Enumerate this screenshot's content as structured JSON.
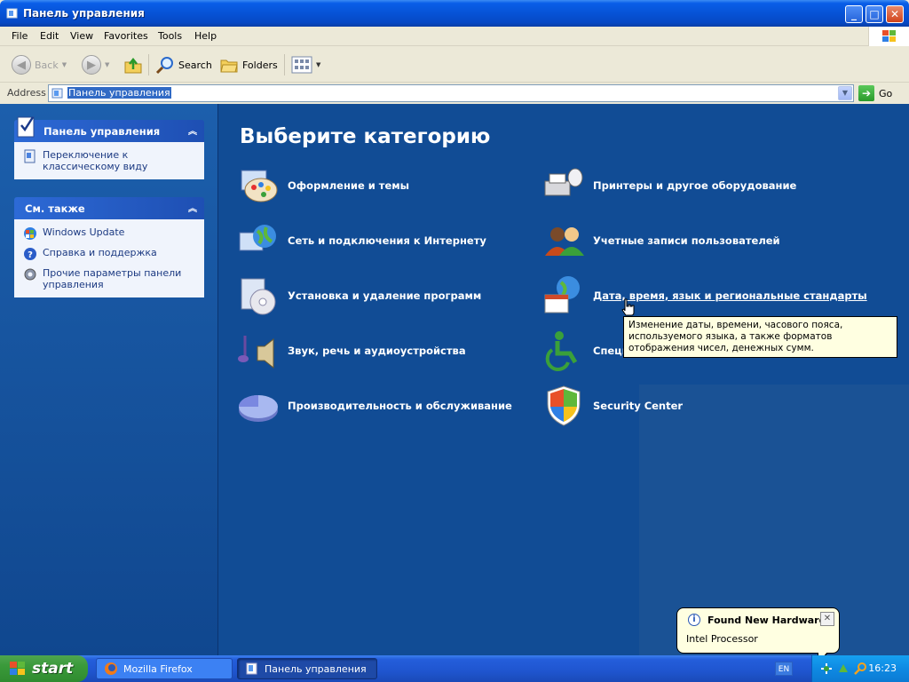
{
  "window": {
    "title": "Панель управления",
    "minimize": "_",
    "maximize": "□",
    "close": "✕"
  },
  "menu": [
    "File",
    "Edit",
    "View",
    "Favorites",
    "Tools",
    "Help"
  ],
  "toolbar": {
    "back": "Back",
    "search": "Search",
    "folders": "Folders"
  },
  "address": {
    "label": "Address",
    "value": "Панель управления",
    "go": "Go"
  },
  "sidebar": {
    "panel1": {
      "title": "Панель управления",
      "items": [
        {
          "label": "Переключение к классическому виду",
          "icon": "switch-view-icon"
        }
      ]
    },
    "panel2": {
      "title": "См. также",
      "items": [
        {
          "label": "Windows Update",
          "icon": "windows-update-icon"
        },
        {
          "label": "Справка и поддержка",
          "icon": "help-icon"
        },
        {
          "label": "Прочие параметры панели управления",
          "icon": "gear-icon"
        }
      ]
    }
  },
  "main": {
    "heading": "Выберите категорию",
    "categories": [
      {
        "label": "Оформление и темы",
        "icon": "appearance-themes-icon"
      },
      {
        "label": "Сеть и подключения к Интернету",
        "icon": "network-globe-icon"
      },
      {
        "label": "Установка и удаление программ",
        "icon": "add-remove-programs-icon"
      },
      {
        "label": "Звук, речь и аудиоустройства",
        "icon": "sound-speaker-icon"
      },
      {
        "label": "Производительность и обслуживание",
        "icon": "performance-pie-icon"
      },
      {
        "label": "Принтеры и другое оборудование",
        "icon": "printer-icon"
      },
      {
        "label": "Учетные записи пользователей",
        "icon": "user-accounts-icon"
      },
      {
        "label": "Дата, время, язык и региональные стандарты",
        "icon": "date-time-globe-icon"
      },
      {
        "label": "Специ",
        "icon": "accessibility-icon"
      },
      {
        "label": "Security Center",
        "icon": "security-shield-icon"
      }
    ],
    "tooltip": "Изменение даты, времени, часового пояса, используемого языка, а также форматов отображения чисел, денежных сумм."
  },
  "taskbar": {
    "start": "start",
    "tasks": [
      {
        "label": "Mozilla Firefox"
      },
      {
        "label": "Панель управления"
      }
    ],
    "lang": "EN",
    "clock": "16:23"
  },
  "balloon": {
    "title": "Found New Hardware",
    "body": "Intel Processor"
  },
  "colors": {
    "titlebar": "#0653d6",
    "content_bg": "#114c95",
    "sidebar_panel_bg": "#f0f4fc",
    "start_green": "#3a9a3a",
    "tooltip_bg": "#ffffe1"
  }
}
